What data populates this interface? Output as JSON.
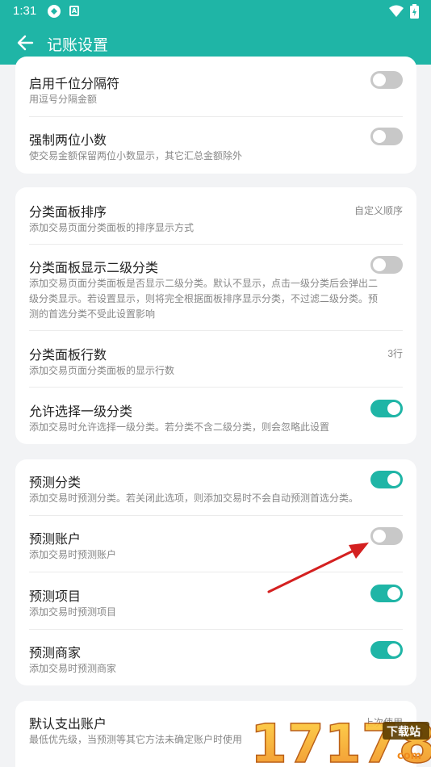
{
  "status_bar": {
    "time": "1:31",
    "icons": [
      "app-icon",
      "a-badge-icon",
      "wifi-icon",
      "battery-icon"
    ],
    "badge_letter": "A"
  },
  "app_bar": {
    "title": "记账设置",
    "back_icon": "arrow-left-icon"
  },
  "card1": {
    "items": [
      {
        "title": "启用千位分隔符",
        "subtitle": "用逗号分隔金额",
        "toggle": false
      },
      {
        "title": "强制两位小数",
        "subtitle": "使交易金额保留两位小数显示，其它汇总金额除外",
        "toggle": false
      }
    ]
  },
  "card2": {
    "items": [
      {
        "title": "分类面板排序",
        "subtitle": "添加交易页面分类面板的排序显示方式",
        "value": "自定义顺序"
      },
      {
        "title": "分类面板显示二级分类",
        "subtitle_lines": [
          "添加交易页面分类面板是否显示二级分类。默认不显示，点击一级分类后会弹出二",
          "级分类显示。若设置显示，则将完全根据面板排序显示分类，不过滤二级分类。预",
          "测的首选分类不受此设置影响"
        ],
        "toggle": false
      },
      {
        "title": "分类面板行数",
        "subtitle": "添加交易页面分类面板的显示行数",
        "value": "3行"
      },
      {
        "title": "允许选择一级分类",
        "subtitle": "添加交易时允许选择一级分类。若分类不含二级分类，则会忽略此设置",
        "toggle": true
      }
    ]
  },
  "card3": {
    "items": [
      {
        "title": "预测分类",
        "subtitle": "添加交易时预测分类。若关闭此选项，则添加交易时不会自动预测首选分类。",
        "toggle": true
      },
      {
        "title": "预测账户",
        "subtitle": "添加交易时预测账户",
        "toggle": false
      },
      {
        "title": "预测项目",
        "subtitle": "添加交易时预测项目",
        "toggle": true
      },
      {
        "title": "预测商家",
        "subtitle": "添加交易时预测商家",
        "toggle": true
      }
    ]
  },
  "card4": {
    "items": [
      {
        "title": "默认支出账户",
        "subtitle": "最低优先级，当预测等其它方法未确定账户时使用",
        "value": "上次使用"
      }
    ]
  },
  "watermark": {
    "text": "17178",
    "badge": "下载站",
    "domain": "com"
  },
  "colors": {
    "accent": "#1fb5a6",
    "arrow": "#d42020",
    "toggle_off": "#c8c8c8"
  }
}
